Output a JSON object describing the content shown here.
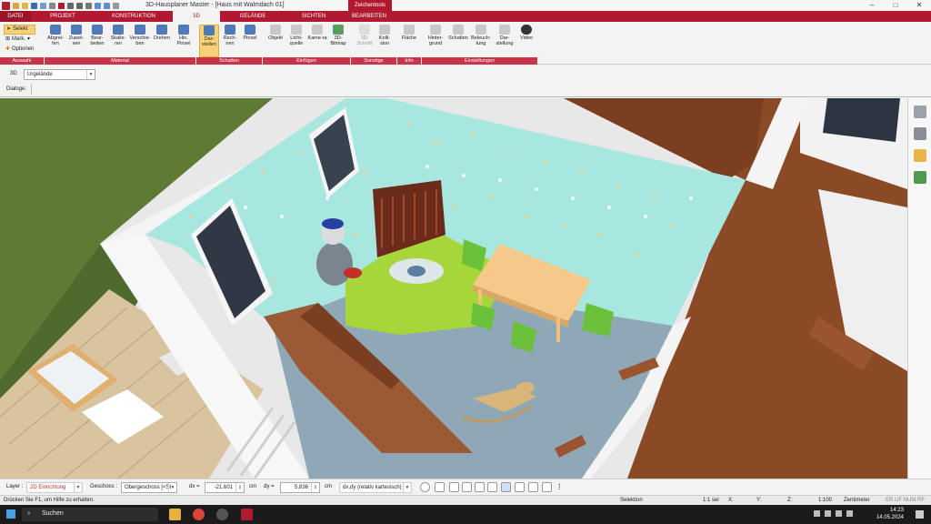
{
  "window": {
    "title": "3D-Hausplaner Master - [Haus mit Walmdach 01]",
    "contextual_tab": "Zeichentools",
    "controls": [
      "–",
      "□",
      "✕"
    ]
  },
  "tabs": [
    {
      "label": "DATEI",
      "active": false
    },
    {
      "label": "PROJEKT",
      "active": false
    },
    {
      "label": "KONSTRUKTION",
      "active": false
    },
    {
      "label": "3D",
      "active": true
    },
    {
      "label": "GELÄNDE",
      "active": false
    },
    {
      "label": "SICHTEN",
      "active": false
    },
    {
      "label": "BEARBEITEN",
      "active": false
    }
  ],
  "ribbon": {
    "selection": {
      "select": "Selekt",
      "mark": "Mark.",
      "options": "Optionen"
    },
    "buttons": [
      {
        "label": "Abgrei-fen",
        "icon": "eyedropper-icon"
      },
      {
        "label": "Zuwei-sen",
        "icon": "assign-icon"
      },
      {
        "label": "Bear-beiten",
        "icon": "edit-material-icon"
      },
      {
        "label": "Skalie-ren",
        "icon": "scale-icon"
      },
      {
        "label": "Verschie-ben",
        "icon": "move-icon"
      },
      {
        "label": "Drehen",
        "icon": "rotate-icon"
      },
      {
        "label": "Hin. Pinsel",
        "icon": "brush-icon"
      },
      {
        "label": "Dar-stellen",
        "icon": "shadow-display-icon",
        "active": true
      },
      {
        "label": "Rech-nen",
        "icon": "calculate-icon"
      },
      {
        "label": "Pinsel",
        "icon": "paint-brush-icon"
      },
      {
        "label": "Objekt",
        "icon": "object-icon"
      },
      {
        "label": "Licht-quelle",
        "icon": "light-source-icon"
      },
      {
        "label": "Kame-ra",
        "icon": "camera-icon"
      },
      {
        "label": "3D-Bitmap",
        "icon": "tree-bitmap-icon"
      },
      {
        "label": "3D-Schnitt",
        "icon": "section-icon",
        "disabled": true
      },
      {
        "label": "Kolli-sion",
        "icon": "collision-icon"
      },
      {
        "label": "Fläche",
        "icon": "area-icon"
      },
      {
        "label": "Hinter-grund",
        "icon": "background-icon"
      },
      {
        "label": "Schatten",
        "icon": "shadow-icon"
      },
      {
        "label": "Beleuch-tung",
        "icon": "lighting-icon"
      },
      {
        "label": "Dar-stellung",
        "icon": "display-icon"
      },
      {
        "label": "Video",
        "icon": "video-icon"
      }
    ],
    "groups": [
      "Auswahl",
      "Material",
      "Schatten",
      "Einfügen",
      "Sonstige",
      "Info",
      "Einstellungen"
    ]
  },
  "subbar": {
    "view_label": "3D",
    "view_value": "Urgelände",
    "dialog_label": "Dialoge:"
  },
  "statusbar": {
    "layer_label": "Layer :",
    "layer_value": "2D Einrichtung",
    "floor_label": "Geschoss :",
    "floor_value": "Obergeschoss [<St",
    "dx_label": "dx =",
    "dx_value": "-21,601",
    "dx_unit": "cm",
    "dy_label": "dy =",
    "dy_value": "5,836",
    "dy_unit": "cm",
    "mode_value": "dx,dy (relativ kartesisch)"
  },
  "statusbar2": {
    "hint": "Drücken Sie F1, um Hilfe zu erhalten.",
    "mode": "Selektion",
    "scale_sel": "1:1 sel",
    "x": "X:",
    "y": "Y:",
    "z": "Z:",
    "scale": "1:100",
    "unit": "Zentimeter",
    "flags": "ER  UF  NUM  RF"
  },
  "taskbar": {
    "search_placeholder": "Suchen",
    "time": "14:23",
    "date": "14.05.2024"
  },
  "colors": {
    "brand": "#b0192f",
    "group_label": "#c9344a",
    "active_button": "#f7d27a",
    "wallpaper": "#a8e6e0",
    "carpet_green": "#a6d63a",
    "carpet_blue": "#8fa8b8",
    "wood_floor": "#8b4a26",
    "table": "#f5c98a",
    "chair": "#6bc13a"
  }
}
